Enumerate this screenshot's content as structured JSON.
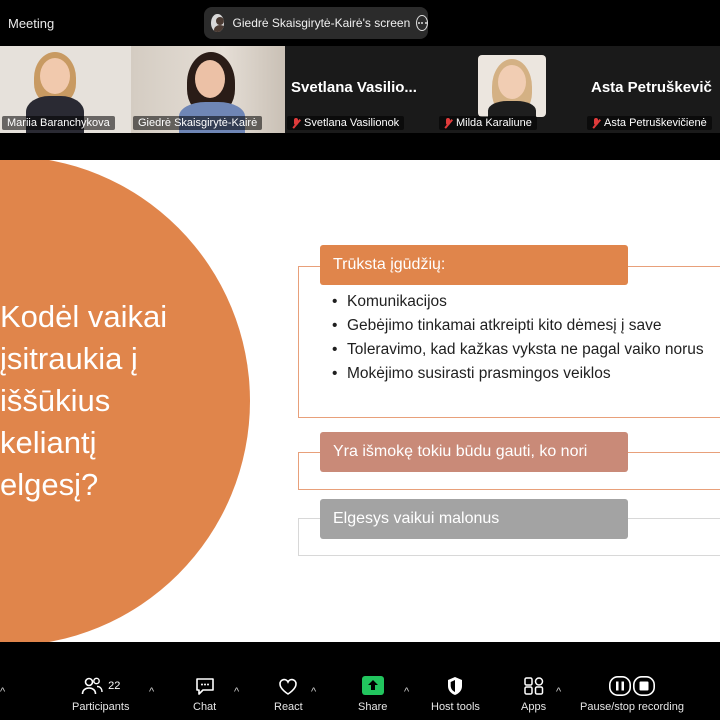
{
  "window": {
    "title": "Meeting"
  },
  "share_banner": {
    "text": "Giedrė Skaisgirytė-Kairė's screen"
  },
  "participants_strip": [
    {
      "name": "Mariia Baranchykova",
      "video": true,
      "muted": false
    },
    {
      "name": "Giedrė Skaisgirytė-Kairė",
      "video": true,
      "muted": false,
      "speaking": true
    },
    {
      "name": "Svetlana Vasilionok",
      "display_name_large": "Svetlana  Vasilio...",
      "video": false,
      "muted": true
    },
    {
      "name": "Milda Karaliune",
      "video": true,
      "muted": true
    },
    {
      "name": "Asta Petruškevičienė",
      "display_name_large": "Asta  Petruškevič",
      "video": false,
      "muted": true
    }
  ],
  "slide": {
    "question": [
      "Kodėl vaikai",
      "įsitraukia į",
      "iššūkius",
      "keliantį",
      "elgesį?"
    ],
    "sections": [
      {
        "heading": "Trūksta įgūdžių:",
        "color": "#e0854b",
        "bullets": [
          "Komunikacijos",
          "Gebėjimo tinkamai atkreipti kito dėmesį į save",
          "Toleravimo, kad kažkas vyksta ne pagal vaiko norus",
          "Mokėjimo susirasti prasmingos veiklos"
        ]
      },
      {
        "heading": "Yra išmokę tokiu būdu gauti, ko nori",
        "color": "#c98a78"
      },
      {
        "heading": "Elgesys vaikui malonus",
        "color": "#a3a3a3"
      }
    ],
    "accent_color": "#e0854b"
  },
  "toolbar": {
    "participants": {
      "label": "Participants",
      "count": "22"
    },
    "chat": {
      "label": "Chat"
    },
    "react": {
      "label": "React"
    },
    "share": {
      "label": "Share"
    },
    "host_tools": {
      "label": "Host tools"
    },
    "apps": {
      "label": "Apps"
    },
    "recording": {
      "label": "Pause/stop recording"
    }
  }
}
